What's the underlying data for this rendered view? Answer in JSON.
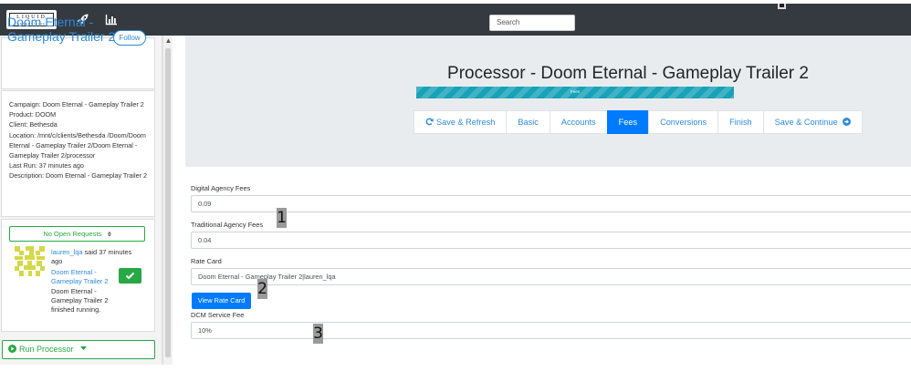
{
  "navbar": {
    "logo_text": "LIQUID",
    "logo_subtext": "ADVERTISING",
    "icons": [
      "rocket-icon",
      "bar-chart-icon"
    ],
    "search_placeholder": "Search",
    "background": "#343a40"
  },
  "sidebar": {
    "title": "Doom Eternal - Gameplay Trailer 2",
    "follow_label": "Follow",
    "details": [
      "Campaign: Doom Eternal - Gameplay Trailer 2",
      "Product: DOOM",
      "Client: Bethesda",
      "Location: /mnt/c/clients/Bethesda /Doom/Doom Eternal - Gameplay Trailer 2/Doom Eternal - Gameplay Trailer 2/processor",
      "Last Run: 37 minutes ago",
      "Description: Doom Eternal - Gameplay Trailer 2"
    ],
    "open_requests_label": "No Open Requests",
    "open_requests_count": "0",
    "message": {
      "user": "lauren_lqa",
      "said": " said 37 minutes ago",
      "link": "Doom Eternal - Gameplay Trailer 2",
      "body": "Doom Eternal - Gameplay Trailer 2 finished running."
    },
    "run_label": "Run Processor"
  },
  "header": {
    "title": "Processor - Doom Eternal - Gameplay Trailer 2",
    "progress_label": "Fees",
    "progress_value": 1.0,
    "progress_color": "#17a2b8"
  },
  "tabs": [
    {
      "label": "Save & Refresh",
      "icon": "refresh-icon",
      "active": false
    },
    {
      "label": "Basic",
      "active": false
    },
    {
      "label": "Accounts",
      "active": false
    },
    {
      "label": "Fees",
      "active": true
    },
    {
      "label": "Conversions",
      "active": false
    },
    {
      "label": "Finish",
      "active": false
    },
    {
      "label": "Save & Continue",
      "icon": "arrow-right-circle-icon",
      "active": false
    }
  ],
  "form": {
    "digital_fees_label": "Digital Agency Fees",
    "digital_fees_value": "0.09",
    "traditional_fees_label": "Traditional Agency Fees",
    "traditional_fees_value": "0.04",
    "rate_card_label": "Rate Card",
    "rate_card_value": "Doom Eternal - Gameplay Trailer 2|lauren_lqa",
    "view_rate_card_label": "View Rate Card",
    "dcm_fee_label": "DCM Service Fee",
    "dcm_fee_value": "10%"
  },
  "markers": [
    "1",
    "2",
    "3"
  ],
  "colors": {
    "accent": "#007bff",
    "link": "#2e8ad9",
    "success": "#28a745"
  }
}
